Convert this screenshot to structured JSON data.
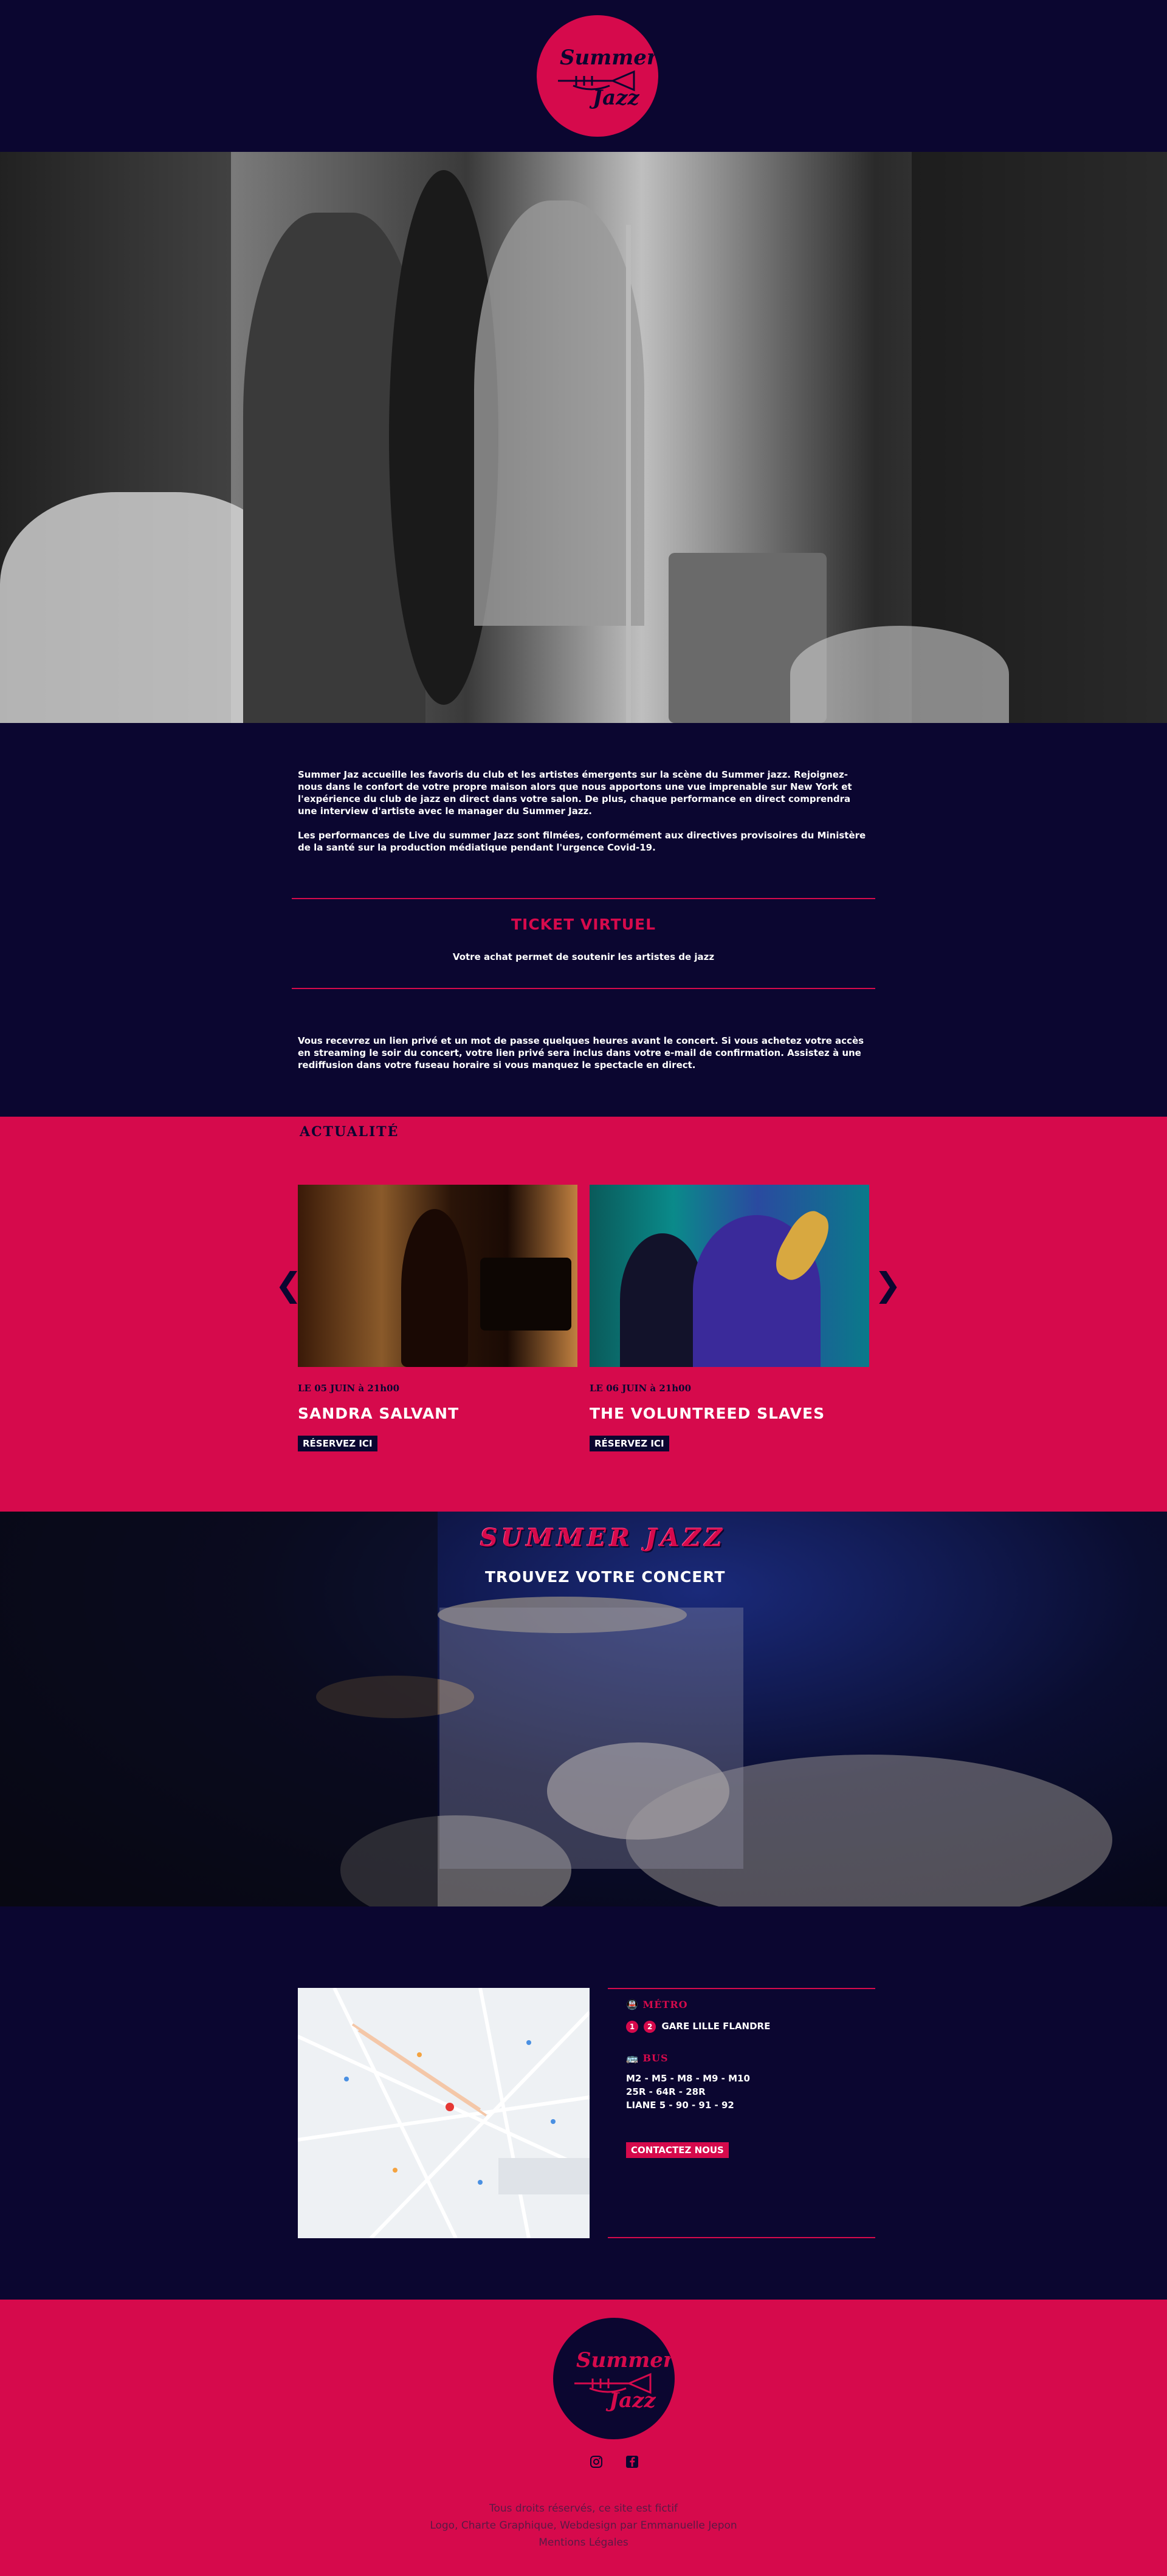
{
  "logo": {
    "line1": "Summer",
    "line2": "Jazz"
  },
  "intro": {
    "paragraph1": "Summer Jaz accueille les favoris du club et les artistes émergents sur la scène du Summer jazz. Rejoignez-nous dans le confort de votre propre maison alors que nous apportons une vue imprenable sur New York et l'expérience du club de jazz en direct dans votre salon. De plus, chaque performance en direct comprendra une interview d'artiste avec le manager du Summer Jazz.",
    "paragraph2": "Les performances de Live du summer Jazz sont filmées, conformément aux directives provisoires du Ministère de la santé sur la production médiatique pendant l'urgence Covid-19."
  },
  "ticket": {
    "title": "TICKET VIRTUEL",
    "subtitle": "Votre achat permet de soutenir les artistes de jazz"
  },
  "access_text": "Vous recevrez un lien privé et un mot de passe quelques heures avant le concert. Si vous achetez votre accès en streaming le soir du concert, votre lien privé sera inclus dans votre e-mail de confirmation. Assistez à une rediffusion dans votre fuseau horaire si vous manquez le spectacle en direct.",
  "news": {
    "title": "ACTUALITÉ",
    "prev": "❮",
    "next": "❯",
    "cards": [
      {
        "date": "LE 05 JUIN à 21h00",
        "name": "SANDRA SALVANT",
        "button": "RÉSERVEZ ICI"
      },
      {
        "date": "LE 06 JUIN à 21h00",
        "name": "THE VOLUNTREED SLAVES",
        "button": "RÉSERVEZ ICI"
      }
    ]
  },
  "concert": {
    "brand": "SUMMER JAZZ",
    "subtitle": "TROUVEZ VOTRE CONCERT"
  },
  "info": {
    "metro_title": "MÉTRO",
    "metro_badges": [
      "1",
      "2"
    ],
    "metro_station": "GARE LILLE FLANDRE",
    "bus_title": "BUS",
    "bus_lines": [
      "M2 - M5 - M8 - M9 - M10",
      "25R - 64R - 28R",
      "LIANE 5 - 90 - 91 - 92"
    ],
    "contact": "CONTACTEZ NOUS"
  },
  "footer": {
    "legal": [
      "Tous droits réservés, ce site est fictif",
      "Logo, Charte Graphique, Webdesign par Emmanuelle Jepon",
      "Mentions Légales"
    ]
  },
  "colors": {
    "navy": "#0b0630",
    "pink": "#d60a4c"
  },
  "icons": [
    "trumpet-icon",
    "metro-icon",
    "bus-icon",
    "instagram-icon",
    "facebook-icon",
    "chevron-left-icon",
    "chevron-right-icon",
    "map-pin-icon"
  ]
}
